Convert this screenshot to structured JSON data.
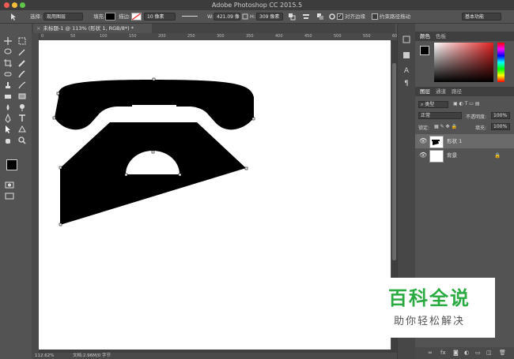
{
  "window": {
    "title": "Adobe Photoshop CC 2015.5"
  },
  "options": {
    "select_label": "选择:",
    "select_value": "现用图层",
    "fill_label": "填充:",
    "stroke_label": "描边:",
    "stroke_size": "10 像素",
    "w_label": "W:",
    "w_value": "421.09 像",
    "h_label": "H:",
    "h_value": "309 像素",
    "align_edges": "对齐边缘",
    "constrain_path": "约束路径拖动",
    "workspace": "基本功能"
  },
  "document": {
    "tab_title": "未标题-1 @ 113% (形状 1, RGB/8*) *",
    "ruler_ticks": [
      "0",
      "50",
      "100",
      "150",
      "200",
      "250",
      "300",
      "350",
      "400",
      "450",
      "500",
      "550",
      "600"
    ]
  },
  "status": {
    "zoom": "112.62%",
    "doc_info": "文档:2.96M/0 字节"
  },
  "panels": {
    "color_tabs": [
      "颜色",
      "色板"
    ],
    "layer_tabs": [
      "图层",
      "通道",
      "路径"
    ],
    "filter_kind": "类型",
    "blend_mode": "正常",
    "opacity_label": "不透明度:",
    "opacity_value": "100%",
    "lock_label": "锁定:",
    "fill_label": "填充:",
    "fill_value": "100%",
    "layers": [
      {
        "name": "形状 1",
        "selected": true
      },
      {
        "name": "背景",
        "selected": false
      }
    ]
  },
  "watermark": {
    "title": "百科全说",
    "subtitle": "助你轻松解决"
  },
  "colors": {
    "ui_bg": "#535353",
    "accent_green": "#2aaa41",
    "shape_fill": "#000000"
  },
  "icons": {
    "tools": [
      "move-icon",
      "marquee-icon",
      "lasso-icon",
      "magic-wand-icon",
      "crop-icon",
      "eyedropper-icon",
      "healing-icon",
      "brush-icon",
      "stamp-icon",
      "history-brush-icon",
      "eraser-icon",
      "gradient-icon",
      "blur-icon",
      "dodge-icon",
      "pen-icon",
      "type-icon",
      "path-select-icon",
      "shape-icon",
      "hand-icon",
      "zoom-icon"
    ]
  }
}
